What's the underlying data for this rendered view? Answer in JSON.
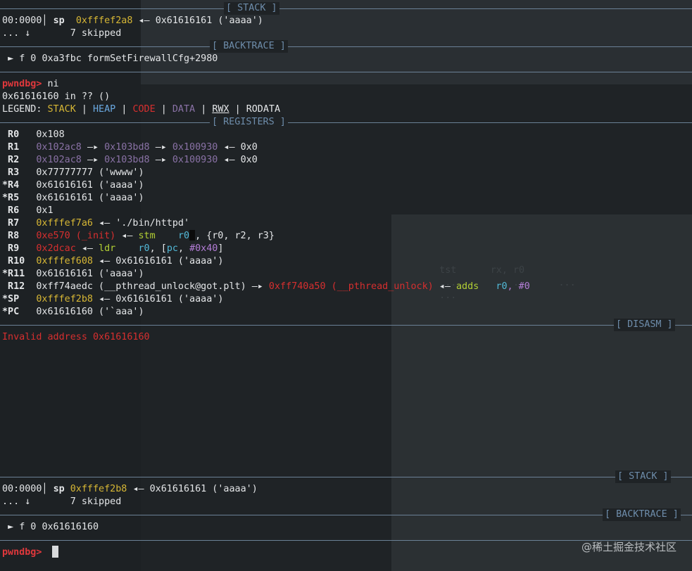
{
  "separators": {
    "stack_top": "[ STACK ]",
    "backtrace_top": "[ BACKTRACE ]",
    "registers": "[ REGISTERS ]",
    "disasm": "[ DISASM ]",
    "stack_bottom": "[ STACK ]",
    "backtrace_bottom": "[ BACKTRACE ]"
  },
  "stack_top": {
    "offset": "00:0000│",
    "reg": "sp",
    "addr": "0xfffef2a8",
    "arrow": "◂—",
    "value": "0x61616161 ('aaaa')",
    "skip_dots": "... ↓",
    "skip_text": "7 skipped"
  },
  "backtrace_top": {
    "marker": "►",
    "frame": "f 0",
    "entry": "0xa3fbc formSetFirewallCfg+2980"
  },
  "prompt_label": "pwndbg>",
  "command": " ni",
  "location": "0x61616160 in ?? ()",
  "legend": {
    "label": "LEGEND:",
    "stack": "STACK",
    "heap": "HEAP",
    "code": "CODE",
    "data": "DATA",
    "rwx": "RWX",
    "rodata": "RODATA",
    "bar": "|"
  },
  "registers": {
    "r0": {
      "name": " R0",
      "value": "0x108"
    },
    "r1": {
      "name": " R1",
      "v1": "0x102ac8",
      "a1": "—▸",
      "v2": "0x103bd8",
      "a2": "—▸",
      "v3": "0x100930",
      "a3": "◂—",
      "v4": "0x0"
    },
    "r2": {
      "name": " R2",
      "v1": "0x102ac8",
      "a1": "—▸",
      "v2": "0x103bd8",
      "a2": "—▸",
      "v3": "0x100930",
      "a3": "◂—",
      "v4": "0x0"
    },
    "r3": {
      "name": " R3",
      "value": "0x77777777 ('wwww')"
    },
    "r4": {
      "name": "*R4",
      "value": "0x61616161 ('aaaa')"
    },
    "r5": {
      "name": "*R5",
      "value": "0x61616161 ('aaaa')"
    },
    "r6": {
      "name": " R6",
      "value": "0x1"
    },
    "r7": {
      "name": " R7",
      "v1": "0xfffef7a6",
      "arrow": "◂—",
      "v2": "'./bin/httpd'"
    },
    "r8": {
      "name": " R8",
      "v1": "0xe570 (_init)",
      "arrow": "◂—",
      "insn": "stm",
      "op1": "r0",
      "rest": ", {r0, r2, r3}"
    },
    "r9": {
      "name": " R9",
      "v1": "0x2dcac",
      "arrow": "◂—",
      "insn": "ldr",
      "op1": "r0",
      "open": ", [",
      "op2": "pc",
      "comma": ", ",
      "imm": "#0x40",
      "close": "]"
    },
    "r10": {
      "name": " R10",
      "v1": "0xfffef608",
      "arrow": "◂—",
      "v2": "0x61616161 ('aaaa')"
    },
    "r11": {
      "name": "*R11",
      "value": "0x61616161 ('aaaa')"
    },
    "r12": {
      "name": " R12",
      "v1": "0xff74aedc (__pthread_unlock@got.plt)",
      "arrow1": "—▸",
      "v2": "0xff740a50 (__pthread_unlock)",
      "arrow2": "◂—",
      "insn": "adds",
      "op1": "r0",
      "op2": ", #0"
    },
    "sp": {
      "name": "*SP",
      "v1": "0xfffef2b8",
      "arrow": "◂—",
      "v2": "0x61616161 ('aaaa')"
    },
    "pc": {
      "name": "*PC",
      "value": "0x61616160 ('`aaa')"
    }
  },
  "invalid_address": "Invalid address 0x61616160",
  "stack_bottom": {
    "offset": "00:0000│",
    "reg": "sp",
    "addr": "0xfffef2b8",
    "arrow": "◂—",
    "value": "0x61616161 ('aaaa')",
    "skip_dots": "... ↓",
    "skip_text": "7 skipped"
  },
  "backtrace_bottom": {
    "marker": "►",
    "frame": "f 0",
    "entry": "0x61616160"
  },
  "watermark": "@稀土掘金技术社区",
  "colors": {
    "background": "#1f2326",
    "stack": "#d7b735",
    "heap": "#6aa8e0",
    "code": "#d62f2f",
    "data": "#8a72a6",
    "separator": "#6e8dab",
    "prompt": "#e0383c"
  }
}
